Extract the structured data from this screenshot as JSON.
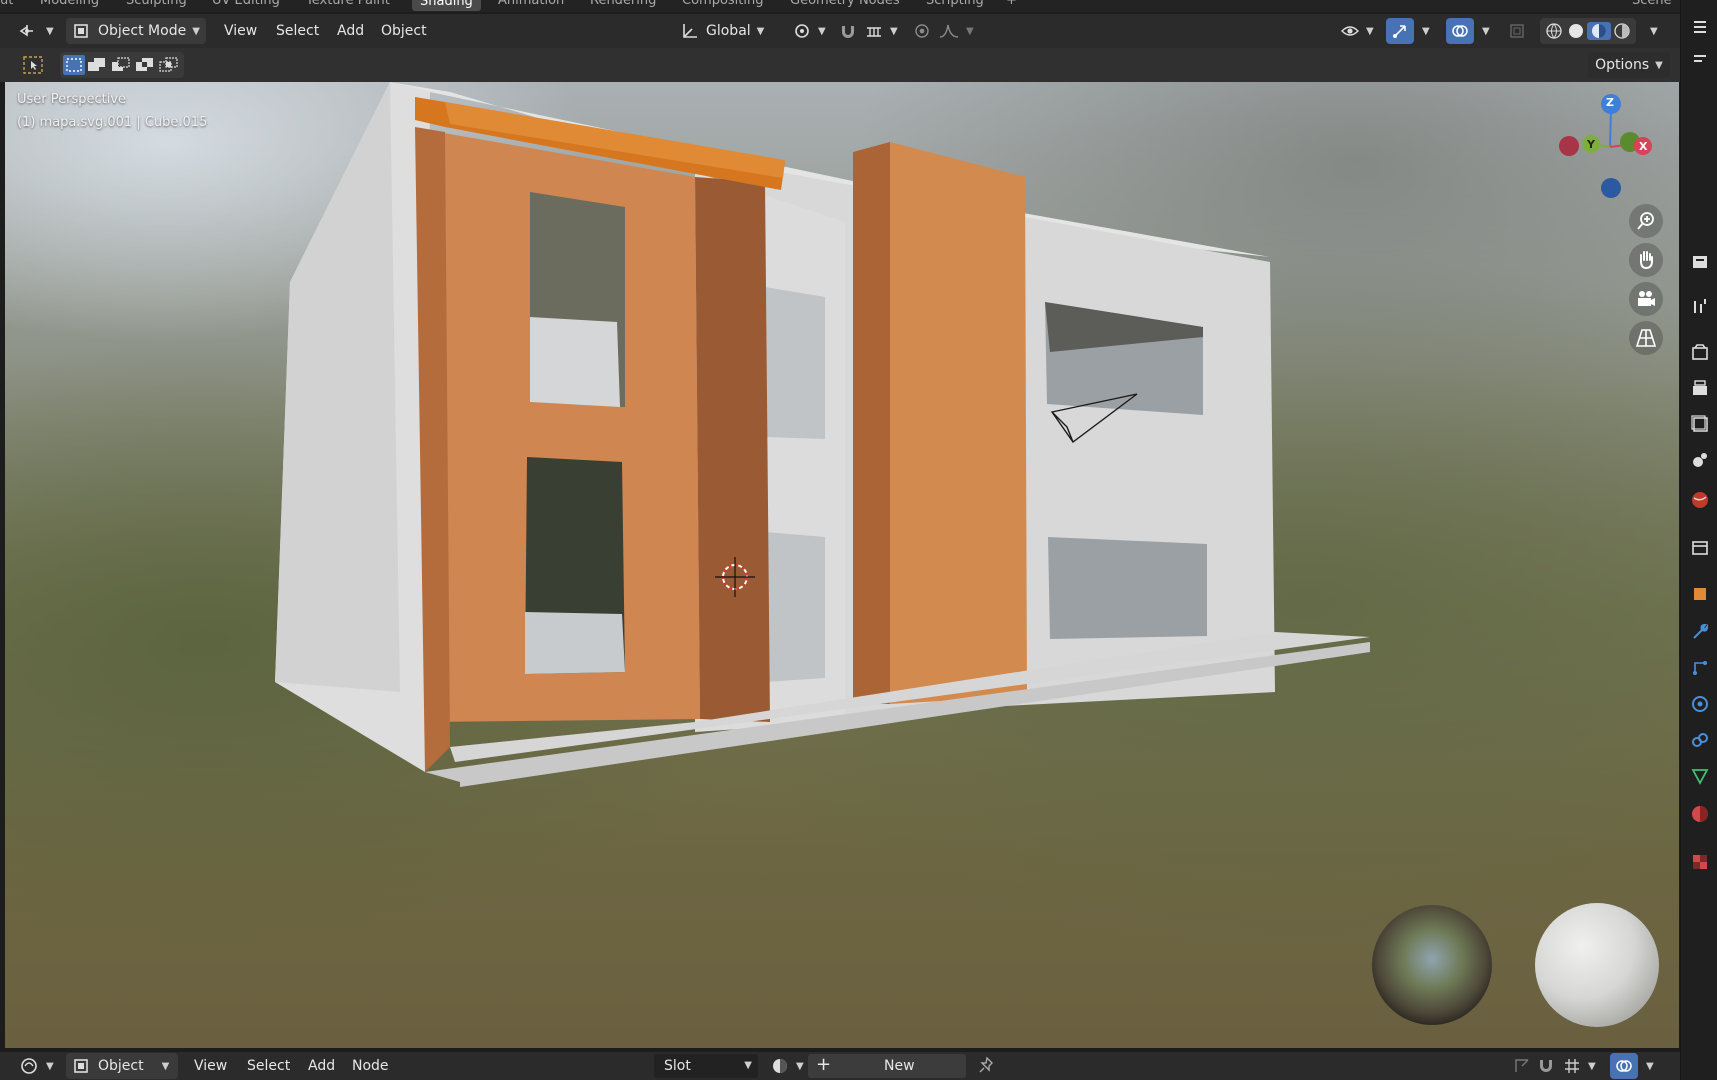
{
  "workspace_tabs": [
    {
      "label": "ut",
      "active": false
    },
    {
      "label": "Modeling",
      "active": false
    },
    {
      "label": "Sculpting",
      "active": false
    },
    {
      "label": "UV Editing",
      "active": false
    },
    {
      "label": "Texture Paint",
      "active": false
    },
    {
      "label": "Shading",
      "active": true
    },
    {
      "label": "Animation",
      "active": false
    },
    {
      "label": "Rendering",
      "active": false
    },
    {
      "label": "Compositing",
      "active": false
    },
    {
      "label": "Geometry Nodes",
      "active": false
    },
    {
      "label": "Scripting",
      "active": false
    },
    {
      "label": "+",
      "active": false
    }
  ],
  "scene_label": "Scene",
  "viewport_header": {
    "mode": "Object Mode",
    "menus": [
      "View",
      "Select",
      "Add",
      "Object"
    ],
    "transform_orientation": "Global"
  },
  "tool_header": {
    "options_label": "Options"
  },
  "viewport": {
    "view_name": "User Perspective",
    "object_info": "(1) mapa.svg.001 | Cube.015",
    "gizmo_axes": [
      "Z",
      "Y",
      "X"
    ]
  },
  "bottom_header": {
    "mode": "Object",
    "menus": [
      "View",
      "Select",
      "Add",
      "Node"
    ],
    "slot_label": "Slot",
    "new_label": "New"
  },
  "colors": {
    "accent_orange": "#c77a3f",
    "wall": "#d6d6d6",
    "active_blue": "#4772b3",
    "axis_x": "#d8425b",
    "axis_y": "#7fae3f",
    "axis_z": "#3f7fd8"
  },
  "icons": {
    "editor_type": "view3d-icon",
    "mode": "object-mode-icon",
    "orientation": "transform-global-icon",
    "pivot": "pivot-icon",
    "snap": "snap-magnet-icon",
    "proportional": "proportional-edit-icon",
    "visibility": "eye-icon",
    "gizmo": "gizmo-icon",
    "overlay": "overlay-icon",
    "shading_modes": [
      "wireframe-icon",
      "solid-icon",
      "material-preview-icon",
      "rendered-icon"
    ]
  }
}
